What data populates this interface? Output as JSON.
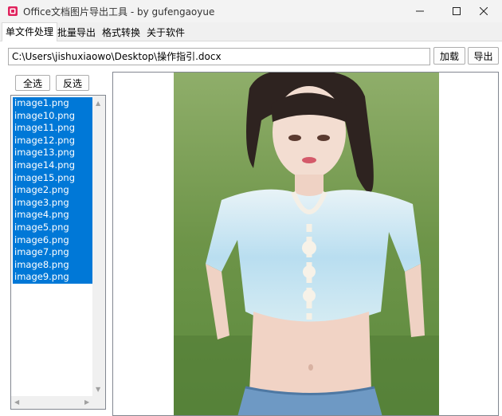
{
  "window": {
    "title": "Office文档图片导出工具 - by gufengaoyue",
    "controls": [
      "minimize",
      "maximize",
      "close"
    ]
  },
  "tabs": [
    {
      "label": "单文件处理",
      "active": true
    },
    {
      "label": "批量导出",
      "active": false
    },
    {
      "label": "格式转换",
      "active": false
    },
    {
      "label": "关于软件",
      "active": false
    }
  ],
  "file": {
    "path": "C:\\Users\\jishuxiaowo\\Desktop\\操作指引.docx",
    "load_label": "加载",
    "export_label": "导出"
  },
  "selection": {
    "select_all_label": "全选",
    "invert_label": "反选"
  },
  "images": [
    "image1.png",
    "image10.png",
    "image11.png",
    "image12.png",
    "image13.png",
    "image14.png",
    "image15.png",
    "image2.png",
    "image3.png",
    "image4.png",
    "image5.png",
    "image6.png",
    "image7.png",
    "image8.png",
    "image9.png"
  ],
  "colors": {
    "selection": "#0078d7",
    "accent_icon": "#e0245e"
  }
}
